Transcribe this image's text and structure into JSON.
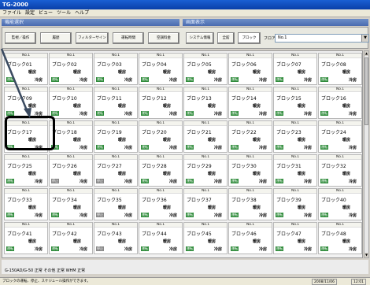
{
  "app": {
    "title": "TG-2000"
  },
  "menu": [
    "ファイル",
    "設定",
    "ビュー",
    "ツール",
    "ヘルプ"
  ],
  "panel_headers": {
    "left": "機能選択",
    "right": "画面表示"
  },
  "toolbar": {
    "buttons": [
      "監視／操作",
      "履歴",
      "フィルターサイン",
      "運転時間",
      "空調料金",
      "システム情報",
      "全館",
      "ブロック"
    ],
    "active_button": "ブロック",
    "floor_label": "フロアー",
    "floor_value": "No.1"
  },
  "cells": [
    {
      "no": "No.1",
      "name": "ブロック01",
      "s1": "暖房",
      "s2": "冷房",
      "badge": "運転",
      "badge_type": "run"
    },
    {
      "no": "No.1",
      "name": "ブロック02",
      "s1": "暖房",
      "s2": "冷房",
      "badge": "運転",
      "badge_type": "run"
    },
    {
      "no": "No.1",
      "name": "ブロック03",
      "s1": "暖房",
      "s2": "冷房",
      "badge": "運転",
      "badge_type": "run"
    },
    {
      "no": "No.1",
      "name": "ブロック04",
      "s1": "暖房",
      "s2": "冷房",
      "badge": "運転",
      "badge_type": "run"
    },
    {
      "no": "No.1",
      "name": "ブロック05",
      "s1": "暖房",
      "s2": "冷房",
      "badge": "運転",
      "badge_type": "run"
    },
    {
      "no": "No.1",
      "name": "ブロック06",
      "s1": "暖房",
      "s2": "冷房",
      "badge": "運転",
      "badge_type": "run"
    },
    {
      "no": "No.1",
      "name": "ブロック07",
      "s1": "暖房",
      "s2": "冷房",
      "badge": "運転",
      "badge_type": "run"
    },
    {
      "no": "No.1",
      "name": "ブロック08",
      "s1": "暖房",
      "s2": "冷房",
      "badge": "運転",
      "badge_type": "run"
    },
    {
      "no": "No.1",
      "name": "ブロック09",
      "s1": "暖房",
      "s2": "冷房",
      "badge": "運転",
      "badge_type": "run"
    },
    {
      "no": "No.1",
      "name": "ブロック10",
      "s1": "暖房",
      "s2": "冷房",
      "badge": "運転",
      "badge_type": "run"
    },
    {
      "no": "No.1",
      "name": "ブロック11",
      "s1": "暖房",
      "s2": "冷房",
      "badge": "運転",
      "badge_type": "run"
    },
    {
      "no": "No.1",
      "name": "ブロック12",
      "s1": "暖房",
      "s2": "冷房",
      "badge": "運転",
      "badge_type": "run"
    },
    {
      "no": "No.1",
      "name": "ブロック13",
      "s1": "暖房",
      "s2": "冷房",
      "badge": "運転",
      "badge_type": "run"
    },
    {
      "no": "No.1",
      "name": "ブロック14",
      "s1": "暖房",
      "s2": "冷房",
      "badge": "運転",
      "badge_type": "run"
    },
    {
      "no": "No.1",
      "name": "ブロック15",
      "s1": "暖房",
      "s2": "冷房",
      "badge": "運転",
      "badge_type": "run"
    },
    {
      "no": "No.1",
      "name": "ブロック16",
      "s1": "暖房",
      "s2": "冷房",
      "badge": "運転",
      "badge_type": "run"
    },
    {
      "no": "No.1",
      "name": "ブロック17",
      "s1": "暖房",
      "s2": "冷房",
      "badge": "運転",
      "badge_type": "run"
    },
    {
      "no": "No.1",
      "name": "ブロック18",
      "s1": "暖房",
      "s2": "冷房",
      "badge": "運転",
      "badge_type": "run"
    },
    {
      "no": "No.1",
      "name": "ブロック19",
      "s1": "暖房",
      "s2": "冷房",
      "badge": "運転",
      "badge_type": "run"
    },
    {
      "no": "No.1",
      "name": "ブロック20",
      "s1": "暖房",
      "s2": "冷房",
      "badge": "運転",
      "badge_type": "run"
    },
    {
      "no": "No.1",
      "name": "ブロック21",
      "s1": "暖房",
      "s2": "冷房",
      "badge": "運転",
      "badge_type": "run"
    },
    {
      "no": "No.1",
      "name": "ブロック22",
      "s1": "暖房",
      "s2": "冷房",
      "badge": "運転",
      "badge_type": "run"
    },
    {
      "no": "No.1",
      "name": "ブロック23",
      "s1": "暖房",
      "s2": "冷房",
      "badge": "運転",
      "badge_type": "run"
    },
    {
      "no": "No.1",
      "name": "ブロック24",
      "s1": "暖房",
      "s2": "冷房",
      "badge": "運転",
      "badge_type": "run"
    },
    {
      "no": "No.1",
      "name": "ブロック25",
      "s1": "暖房",
      "s2": "冷房",
      "badge": "運転",
      "badge_type": "run"
    },
    {
      "no": "No.1",
      "name": "ブロック26",
      "s1": "暖房",
      "s2": "冷房",
      "badge": "停止",
      "badge_type": "stop"
    },
    {
      "no": "No.1",
      "name": "ブロック27",
      "s1": "暖房",
      "s2": "冷房",
      "badge": "停止",
      "badge_type": "stop"
    },
    {
      "no": "No.1",
      "name": "ブロック28",
      "s1": "暖房",
      "s2": "冷房",
      "badge": "運転",
      "badge_type": "run"
    },
    {
      "no": "No.1",
      "name": "ブロック29",
      "s1": "暖房",
      "s2": "冷房",
      "badge": "運転",
      "badge_type": "run"
    },
    {
      "no": "No.1",
      "name": "ブロック30",
      "s1": "暖房",
      "s2": "冷房",
      "badge": "運転",
      "badge_type": "run"
    },
    {
      "no": "No.1",
      "name": "ブロック31",
      "s1": "暖房",
      "s2": "冷房",
      "badge": "運転",
      "badge_type": "run"
    },
    {
      "no": "No.1",
      "name": "ブロック32",
      "s1": "暖房",
      "s2": "冷房",
      "badge": "運転",
      "badge_type": "run"
    },
    {
      "no": "No.1",
      "name": "ブロック33",
      "s1": "暖房",
      "s2": "冷房",
      "badge": "運転",
      "badge_type": "run"
    },
    {
      "no": "No.1",
      "name": "ブロック34",
      "s1": "暖房",
      "s2": "冷房",
      "badge": "運転",
      "badge_type": "run"
    },
    {
      "no": "No.1",
      "name": "ブロック35",
      "s1": "暖房",
      "s2": "冷房",
      "badge": "停止",
      "badge_type": "stop"
    },
    {
      "no": "No.1",
      "name": "ブロック36",
      "s1": "暖房",
      "s2": "冷房",
      "badge": "運転",
      "badge_type": "run"
    },
    {
      "no": "No.1",
      "name": "ブロック37",
      "s1": "暖房",
      "s2": "冷房",
      "badge": "運転",
      "badge_type": "run"
    },
    {
      "no": "No.1",
      "name": "ブロック38",
      "s1": "暖房",
      "s2": "冷房",
      "badge": "運転",
      "badge_type": "run"
    },
    {
      "no": "No.1",
      "name": "ブロック39",
      "s1": "暖房",
      "s2": "冷房",
      "badge": "運転",
      "badge_type": "run"
    },
    {
      "no": "No.1",
      "name": "ブロック40",
      "s1": "暖房",
      "s2": "冷房",
      "badge": "運転",
      "badge_type": "run"
    },
    {
      "no": "No.1",
      "name": "ブロック41",
      "s1": "暖房",
      "s2": "冷房",
      "badge": "運転",
      "badge_type": "run"
    },
    {
      "no": "No.1",
      "name": "ブロック42",
      "s1": "暖房",
      "s2": "冷房",
      "badge": "運転",
      "badge_type": "run"
    },
    {
      "no": "No.1",
      "name": "ブロック43",
      "s1": "暖房",
      "s2": "冷房",
      "badge": "停止",
      "badge_type": "stop"
    },
    {
      "no": "No.1",
      "name": "ブロック44",
      "s1": "暖房",
      "s2": "冷房",
      "badge": "運転",
      "badge_type": "run"
    },
    {
      "no": "No.1",
      "name": "ブロック45",
      "s1": "暖房",
      "s2": "冷房",
      "badge": "運転",
      "badge_type": "run"
    },
    {
      "no": "No.1",
      "name": "ブロック46",
      "s1": "暖房",
      "s2": "冷房",
      "badge": "運転",
      "badge_type": "run"
    },
    {
      "no": "No.1",
      "name": "ブロック47",
      "s1": "暖房",
      "s2": "冷房",
      "badge": "運転",
      "badge_type": "run"
    },
    {
      "no": "No.1",
      "name": "ブロック48",
      "s1": "暖房",
      "s2": "冷房",
      "badge": "運転",
      "badge_type": "run"
    }
  ],
  "highlighted_cell": "ブロック17",
  "status": "G-150AD/G-50 正常    その他 正常    WHM 正常",
  "footer": {
    "message": "ブロックの運転、停止、スケジュール操作ができます。",
    "date": "2008/11/06",
    "time": "12:01"
  },
  "colors": {
    "titlebar": "#0a3fa8",
    "badge_run": "#2e8b3a",
    "badge_stop": "#888888"
  }
}
